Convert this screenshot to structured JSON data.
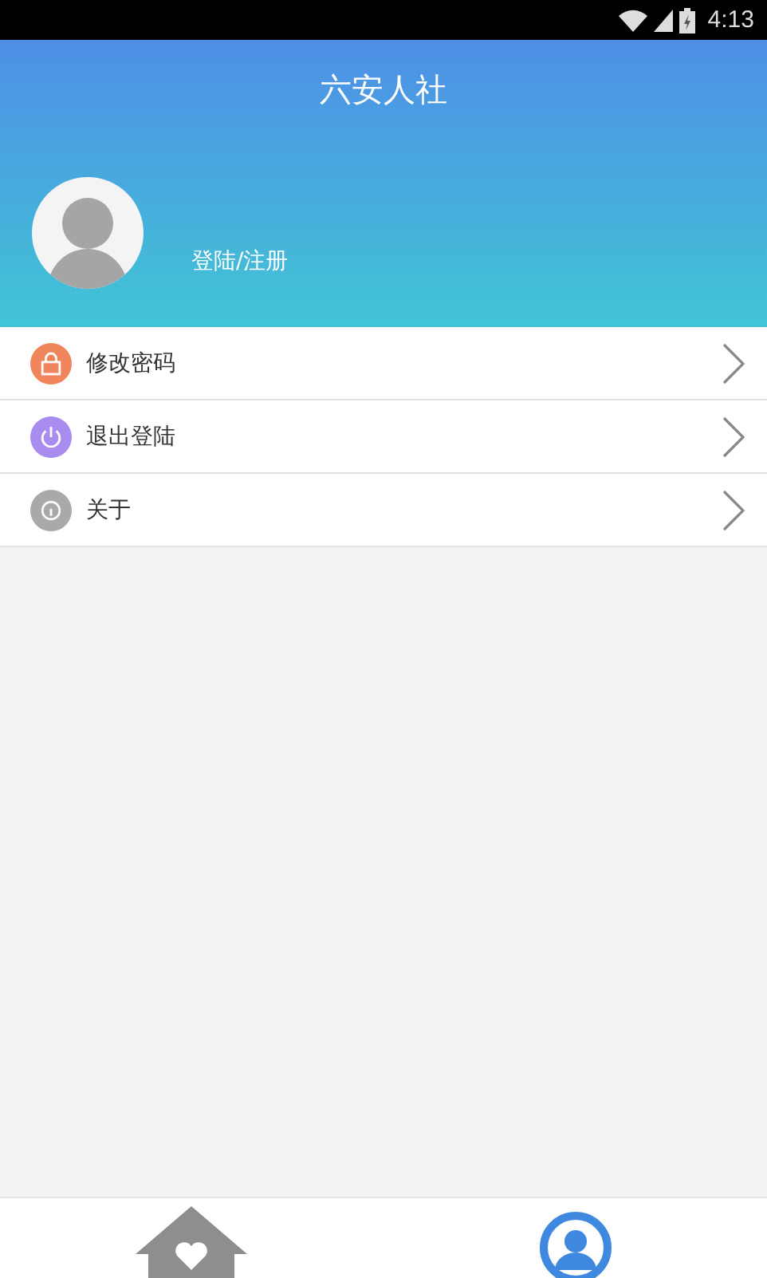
{
  "status_bar": {
    "time": "4:13"
  },
  "header": {
    "title": "六安人社",
    "login_link": "登陆/注册"
  },
  "menu": [
    {
      "kind": "lock",
      "label": "修改密码",
      "color": "#f0845a"
    },
    {
      "kind": "power",
      "label": "退出登陆",
      "color": "#a98cef"
    },
    {
      "kind": "info",
      "label": "关于",
      "color": "#a9a9a9"
    }
  ],
  "tabs": [
    {
      "kind": "home",
      "selected": false
    },
    {
      "kind": "profile",
      "selected": true
    }
  ]
}
